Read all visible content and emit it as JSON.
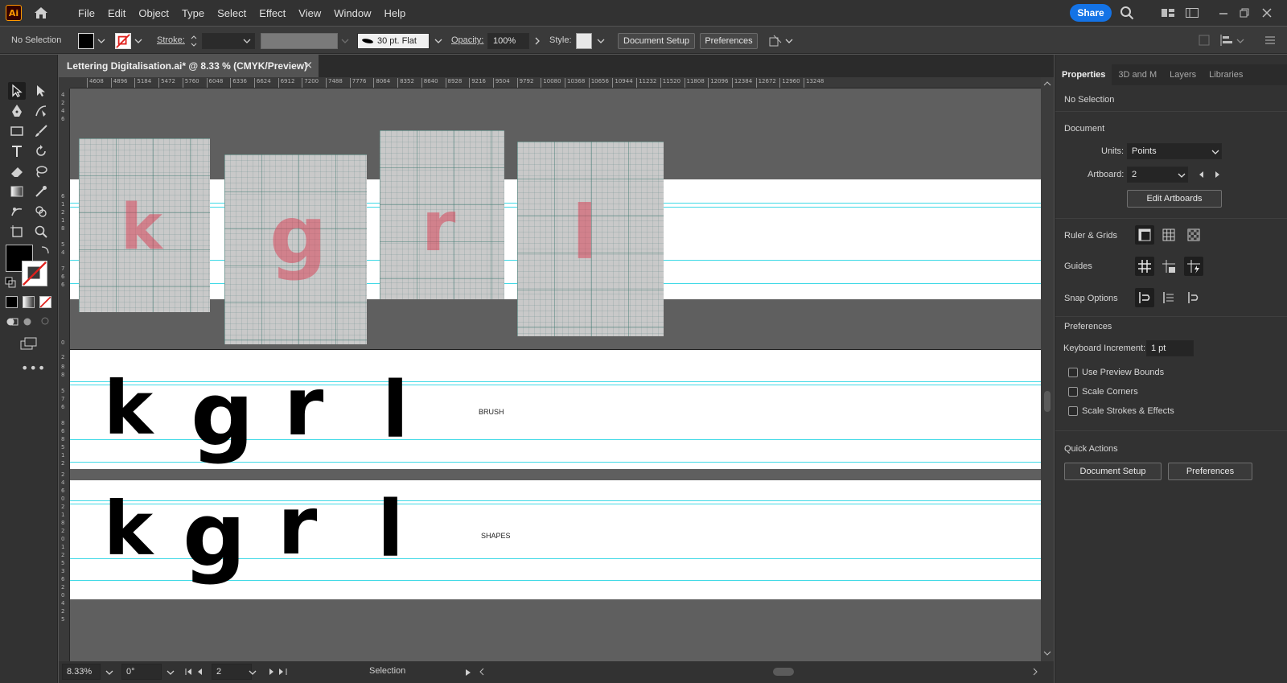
{
  "app": {
    "logo": "Ai"
  },
  "menu": [
    "File",
    "Edit",
    "Object",
    "Type",
    "Select",
    "Effect",
    "View",
    "Window",
    "Help"
  ],
  "share_label": "Share",
  "control_bar": {
    "selection_status": "No Selection",
    "stroke_label": "Stroke:",
    "brush_value": "30 pt. Flat",
    "opacity_label": "Opacity:",
    "opacity_value": "100%",
    "style_label": "Style:",
    "document_setup": "Document Setup",
    "preferences": "Preferences"
  },
  "document_tab": {
    "title": "Lettering Digitalisation.ai* @ 8.33 % (CMYK/Preview)",
    "close": "×"
  },
  "ruler_ticks": [
    "4608",
    "4896",
    "5184",
    "5472",
    "5760",
    "6048",
    "6336",
    "6624",
    "6912",
    "7200",
    "7488",
    "7776",
    "8064",
    "8352",
    "8640",
    "8928",
    "9216",
    "9504",
    "9792",
    "10080",
    "10368",
    "10656",
    "10944",
    "11232",
    "11520",
    "11808",
    "12096",
    "12384",
    "12672",
    "12960",
    "13248"
  ],
  "canvas": {
    "photo_letters": [
      "k",
      "g",
      "r",
      "l"
    ],
    "brush_letters": [
      "k",
      "g",
      "r",
      "l"
    ],
    "brush_label": "BRUSH",
    "shape_letters": [
      "k",
      "g",
      "r",
      "l"
    ],
    "shapes_label": "SHAPES"
  },
  "status_bar": {
    "zoom": "8.33%",
    "rotation": "0°",
    "artboard": "2",
    "tool": "Selection"
  },
  "panel": {
    "tabs": [
      "Properties",
      "3D and M",
      "Layers",
      "Libraries"
    ],
    "no_selection": "No Selection",
    "document_title": "Document",
    "units_label": "Units:",
    "units_value": "Points",
    "artboard_label": "Artboard:",
    "artboard_value": "2",
    "edit_artboards": "Edit Artboards",
    "ruler_grids": "Ruler & Grids",
    "guides": "Guides",
    "snap_options": "Snap Options",
    "preferences_title": "Preferences",
    "keyboard_increment_label": "Keyboard Increment:",
    "keyboard_increment_value": "1 pt",
    "use_preview_bounds": "Use Preview Bounds",
    "scale_corners": "Scale Corners",
    "scale_strokes": "Scale Strokes & Effects",
    "quick_actions": "Quick Actions",
    "document_setup": "Document Setup",
    "preferences": "Preferences"
  },
  "colors": {
    "accent": "#1473e6",
    "guide": "#3fd9e6",
    "logo": "#ff9a00"
  }
}
